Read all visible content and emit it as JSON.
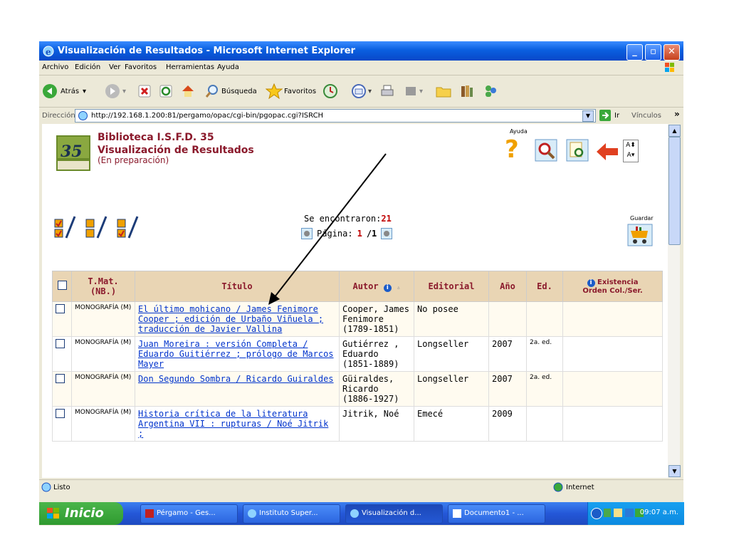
{
  "window": {
    "title": "Visualización de Resultados - Microsoft Internet Explorer"
  },
  "menu": [
    "Archivo",
    "Edición",
    "Ver",
    "Favoritos",
    "Herramientas",
    "Ayuda"
  ],
  "toolbar": {
    "back_label": "Atrás",
    "search_label": "Búsqueda",
    "favorites_label": "Favoritos"
  },
  "address": {
    "label": "Dirección",
    "url": "http://192.168.1.200:81/pergamo/opac/cgi-bin/pgopac.cgi?ISRCH",
    "go_label": "Ir",
    "links_label": "Vínculos"
  },
  "page": {
    "library": "Biblioteca I.S.F.D. 35",
    "heading": "Visualización de Resultados",
    "note": "(En preparación)",
    "help_label": "Ayuda",
    "save_label": "Guardar",
    "found_label": "Se encontraron:",
    "found_count": "21",
    "page_label": "Página:",
    "page_current": "1",
    "page_total": "/1"
  },
  "table": {
    "headers": {
      "tmat": "T.Mat. (NB.)",
      "titulo": "Título",
      "autor": "Autor",
      "editorial": "Editorial",
      "anio": "Año",
      "ed": "Ed.",
      "existencia": "Existencia",
      "orden": "Orden Col./Ser."
    },
    "rows": [
      {
        "tmat": "MONOGRAFÍA (M)",
        "titulo": "El último mohicano / James Fenimore Cooper ; edición de Urbaño Viñuela ; traducción de Javier Vallina",
        "autor": "Cooper, James Fenimore (1789-1851)",
        "editorial": "No posee",
        "anio": "",
        "ed": ""
      },
      {
        "tmat": "MONOGRAFÍA (M)",
        "titulo": "Juan Moreira : versión Completa / Eduardo Guitiérrez ; prólogo de Marcos Mayer",
        "autor": "Gutiérrez , Eduardo (1851-1889)",
        "editorial": "Longseller",
        "anio": "2007",
        "ed": "2a. ed."
      },
      {
        "tmat": "MONOGRAFÍA (M)",
        "titulo": "Don Segundo Sombra / Ricardo Guiraldes",
        "autor": "Güiraldes, Ricardo (1886-1927)",
        "editorial": "Longseller",
        "anio": "2007",
        "ed": "2a. ed."
      },
      {
        "tmat": "MONOGRAFÍA (M)",
        "titulo": "Historia crítica de la literatura Argentina VII : rupturas / Noé Jitrik ;",
        "autor": "Jitrik, Noé",
        "editorial": "Emecé",
        "anio": "2009",
        "ed": ""
      }
    ]
  },
  "status": {
    "text": "Listo",
    "zone": "Internet"
  },
  "taskbar": {
    "start": "Inicio",
    "tasks": [
      "Pérgamo - Ges...",
      "Instituto Super...",
      "Visualización d...",
      "Documento1 - ..."
    ],
    "clock": "09:07 a.m."
  }
}
